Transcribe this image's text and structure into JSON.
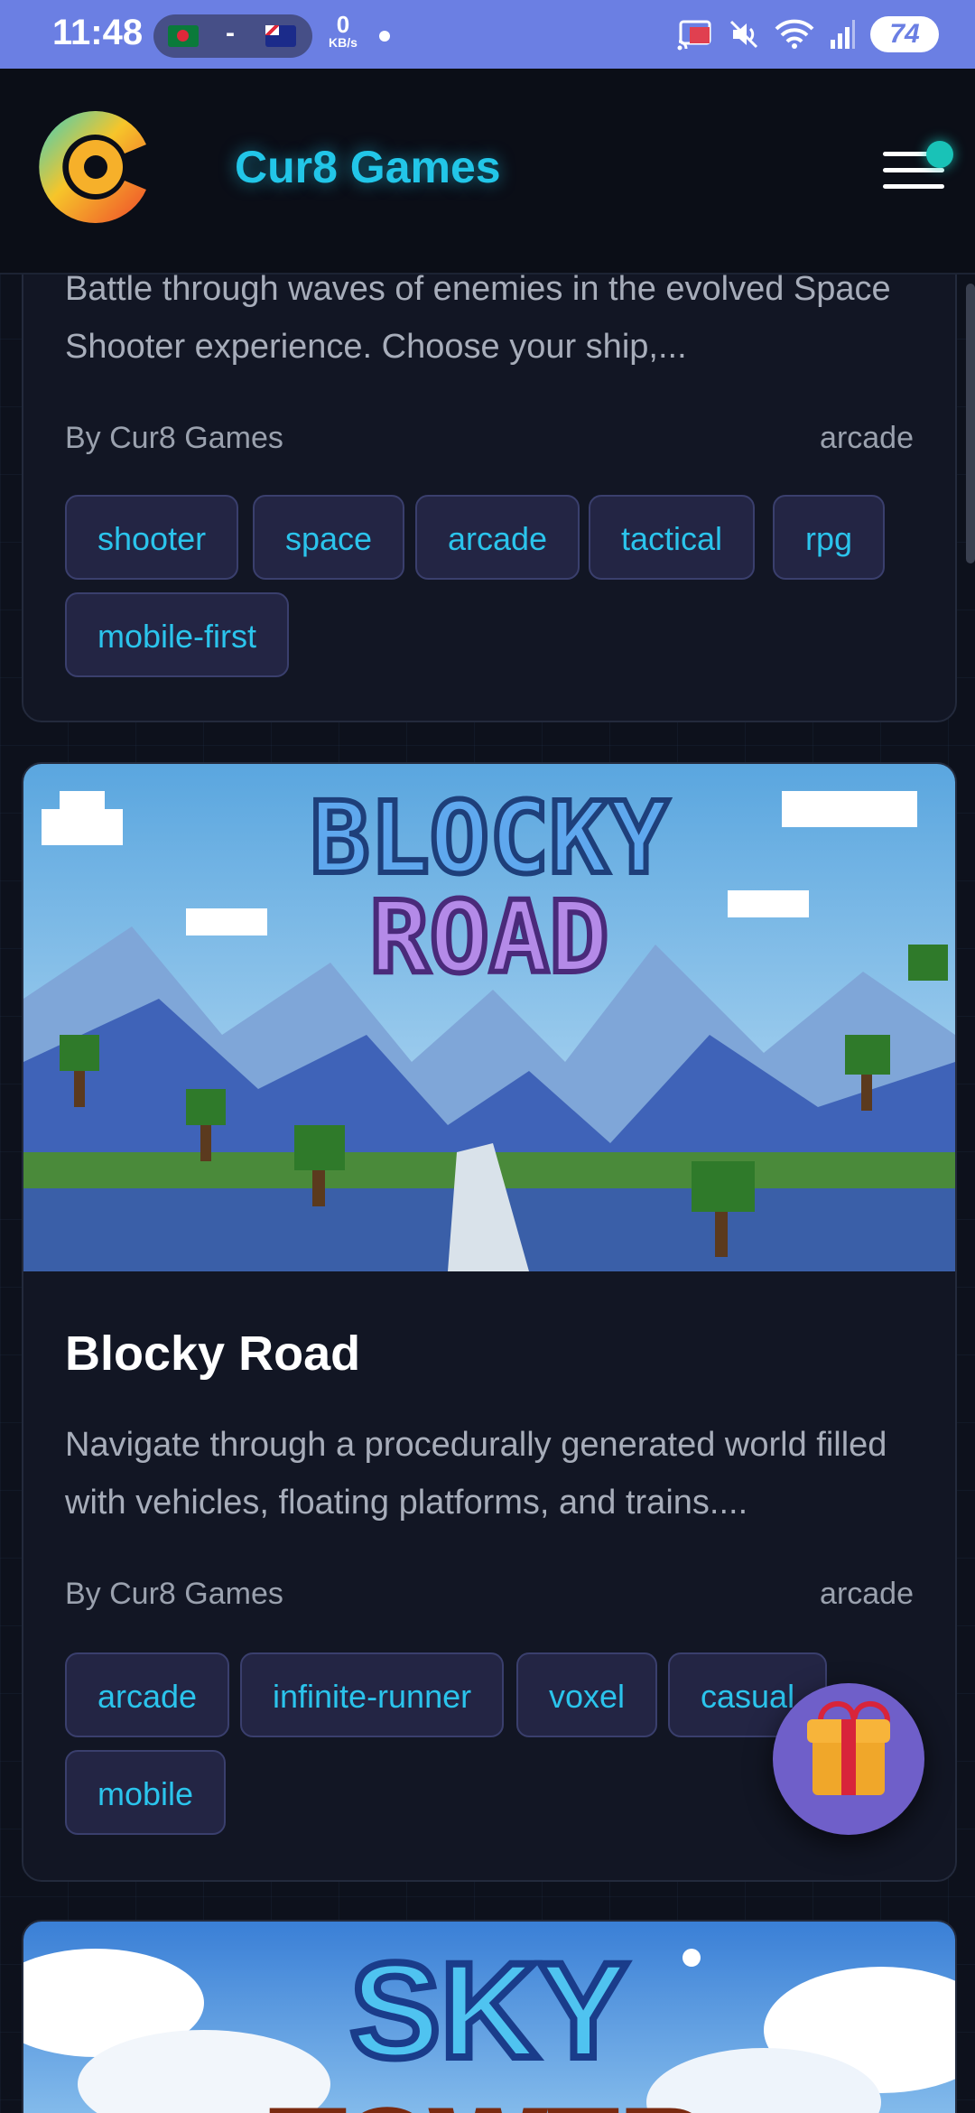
{
  "status_bar": {
    "time": "11:48",
    "pill_separator": "-",
    "net_speed_value": "0",
    "net_speed_unit": "KB/s",
    "battery": "74"
  },
  "header": {
    "brand": "Cur8 Games"
  },
  "cards": [
    {
      "description": "Battle through waves of enemies in the evolved Space Shooter experience. Choose your ship,...",
      "author": "By Cur8 Games",
      "category": "arcade",
      "tags": [
        "shooter",
        "space",
        "arcade",
        "tactical",
        "rpg",
        "mobile-first"
      ]
    },
    {
      "image_title_line1": "BLOCKY",
      "image_title_line2": "ROAD",
      "title": "Blocky Road",
      "description": "Navigate through a procedurally generated world filled with vehicles, floating platforms, and trains....",
      "author": "By Cur8 Games",
      "category": "arcade",
      "tags": [
        "arcade",
        "infinite-runner",
        "voxel",
        "casual",
        "mobile"
      ]
    },
    {
      "image_title_line1": "SKY",
      "image_title_line2": "TOWER"
    }
  ],
  "colors": {
    "accent": "#22c6e8",
    "status_bar": "#6b7fe3",
    "gift_button": "#6f5fc9"
  }
}
